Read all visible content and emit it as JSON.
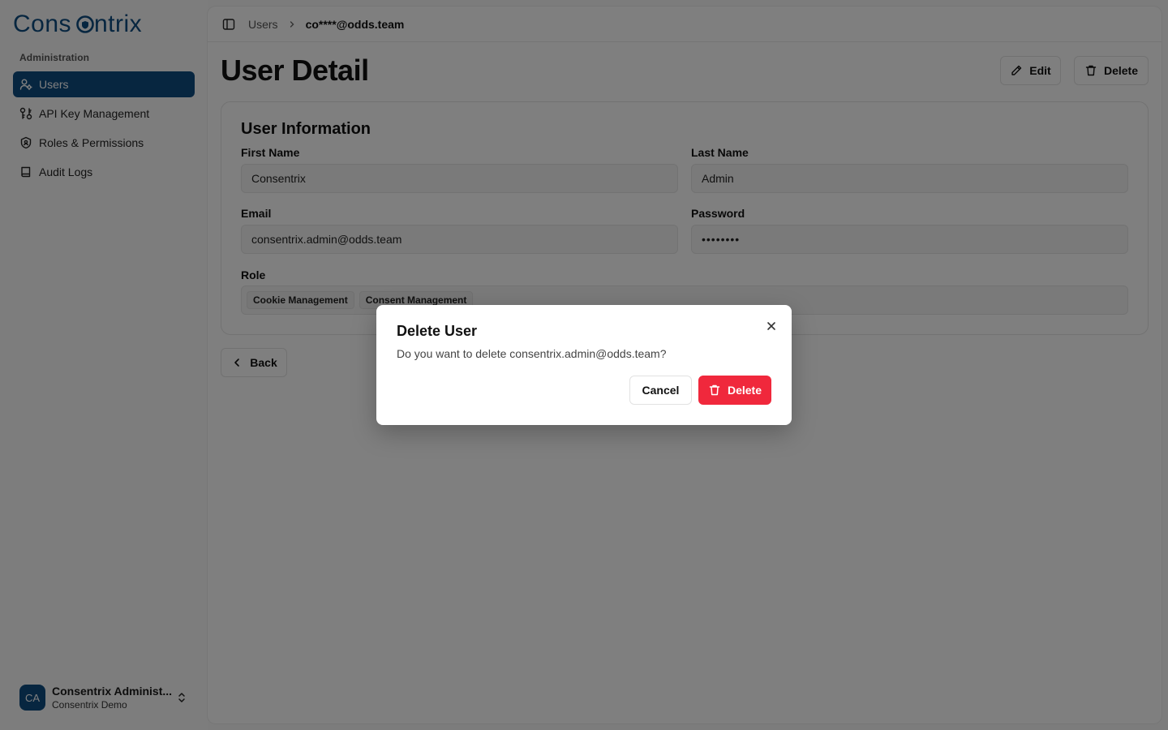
{
  "app": {
    "logo_text": "Consentrix",
    "accent": "#0f4c81",
    "danger": "#f0283c"
  },
  "sidebar": {
    "group_label": "Administration",
    "items": [
      {
        "label": "Users",
        "icon": "users-icon",
        "active": true
      },
      {
        "label": "API Key Management",
        "icon": "key-icon",
        "active": false
      },
      {
        "label": "Roles & Permissions",
        "icon": "shield-icon",
        "active": false
      },
      {
        "label": "Audit Logs",
        "icon": "book-icon",
        "active": false
      }
    ],
    "user": {
      "initials": "CA",
      "name": "Consentrix Administ...",
      "org": "Consentrix Demo"
    }
  },
  "breadcrumb": {
    "parent": "Users",
    "current": "co****@odds.team"
  },
  "page": {
    "title": "User Detail",
    "edit_label": "Edit",
    "delete_label": "Delete",
    "back_label": "Back"
  },
  "user_info": {
    "title": "User Information",
    "first_name_label": "First Name",
    "first_name": "Consentrix",
    "last_name_label": "Last Name",
    "last_name": "Admin",
    "email_label": "Email",
    "email": "consentrix.admin@odds.team",
    "password_label": "Password",
    "password": "••••••••",
    "role_label": "Role",
    "roles": [
      "Cookie Management",
      "Consent Management"
    ]
  },
  "dialog": {
    "title": "Delete User",
    "description": "Do you want to delete consentrix.admin@odds.team?",
    "cancel_label": "Cancel",
    "confirm_label": "Delete"
  }
}
